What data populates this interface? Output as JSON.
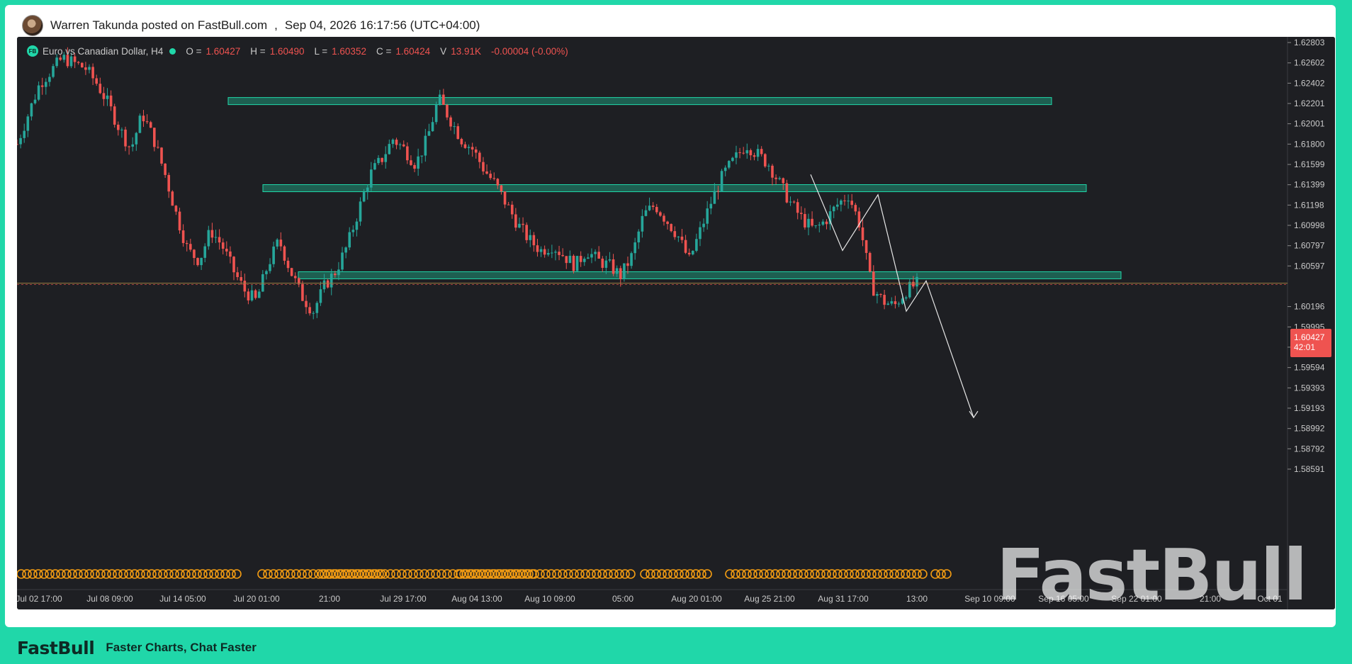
{
  "post": {
    "author_line": "Warren Takunda posted on FastBull.com",
    "separator": ",",
    "timestamp": "Sep 04, 2026 16:17:56 (UTC+04:00)"
  },
  "legend": {
    "badge": "FB",
    "symbol": "Euro vs Canadian Dollar, H4",
    "o_label": "O =",
    "o_value": "1.60427",
    "h_label": "H =",
    "h_value": "1.60490",
    "l_label": "L =",
    "l_value": "1.60352",
    "c_label": "C =",
    "c_value": "1.60424",
    "v_label": "V",
    "v_value": "13.91K",
    "change": "-0.00004 (-0.00%)"
  },
  "price_tag": {
    "price": "1.60427",
    "countdown": "42:01"
  },
  "watermark": "FastBull",
  "footer": {
    "logo": "FastBull",
    "tagline": "Faster Charts, Chat Faster"
  },
  "colors": {
    "background": "#1e1f23",
    "up": "#26a69a",
    "down": "#ef5350",
    "zone": "#20d7a9",
    "price_line": "#9e7f42",
    "event_marker": "#f39c12",
    "brand": "#20d7a9"
  },
  "chart_data": {
    "type": "candlestick",
    "title": "Euro vs Canadian Dollar, H4",
    "ylim": [
      1.5851,
      1.629
    ],
    "y_ticks": [
      "1.62803",
      "1.62602",
      "1.62402",
      "1.62201",
      "1.62001",
      "1.61800",
      "1.61599",
      "1.61399",
      "1.61198",
      "1.60998",
      "1.60797",
      "1.60597",
      "1.60196",
      "1.59995",
      "1.59795",
      "1.59594",
      "1.59393",
      "1.59193",
      "1.58992",
      "1.58792",
      "1.58591"
    ],
    "x_ticks": [
      "Jul 02 17:00",
      "Jul 08 09:00",
      "Jul 14 05:00",
      "Jul 20 01:00",
      "21:00",
      "Jul 29 17:00",
      "Aug 04 13:00",
      "Aug 10 09:00",
      "05:00",
      "Aug 20 01:00",
      "Aug 25 21:00",
      "Aug 31 17:00",
      "13:00",
      "Sep 10 09:00",
      "Sep 16 05:00",
      "Sep 22 01:00",
      "21:00",
      "Oct 01"
    ],
    "close_path": [
      [
        0,
        1.618
      ],
      [
        2,
        1.624
      ],
      [
        4,
        1.6265
      ],
      [
        6,
        1.6255
      ],
      [
        7,
        1.624
      ],
      [
        8,
        1.622
      ],
      [
        9,
        1.6195
      ],
      [
        10,
        1.6175
      ],
      [
        11,
        1.621
      ],
      [
        12,
        1.6185
      ],
      [
        13,
        1.615
      ],
      [
        14,
        1.611
      ],
      [
        15,
        1.6075
      ],
      [
        16,
        1.6065
      ],
      [
        17,
        1.6095
      ],
      [
        18,
        1.608
      ],
      [
        19,
        1.6055
      ],
      [
        20,
        1.6035
      ],
      [
        21,
        1.6025
      ],
      [
        22,
        1.606
      ],
      [
        23,
        1.6085
      ],
      [
        24,
        1.6055
      ],
      [
        25,
        1.603
      ],
      [
        26,
        1.6015
      ],
      [
        27,
        1.604
      ],
      [
        28,
        1.6055
      ],
      [
        29,
        1.608
      ],
      [
        30,
        1.6115
      ],
      [
        31,
        1.615
      ],
      [
        32,
        1.6165
      ],
      [
        33,
        1.6185
      ],
      [
        34,
        1.6175
      ],
      [
        35,
        1.616
      ],
      [
        36,
        1.6185
      ],
      [
        37,
        1.6225
      ],
      [
        38,
        1.6205
      ],
      [
        39,
        1.6185
      ],
      [
        40,
        1.6175
      ],
      [
        41,
        1.6155
      ],
      [
        42,
        1.614
      ],
      [
        43,
        1.612
      ],
      [
        44,
        1.61
      ],
      [
        45,
        1.6085
      ],
      [
        46,
        1.6075
      ],
      [
        47,
        1.608
      ],
      [
        48,
        1.607
      ],
      [
        49,
        1.606
      ],
      [
        50,
        1.6075
      ],
      [
        51,
        1.6065
      ],
      [
        52,
        1.606
      ],
      [
        53,
        1.605
      ],
      [
        54,
        1.607
      ],
      [
        55,
        1.611
      ],
      [
        56,
        1.612
      ],
      [
        57,
        1.6105
      ],
      [
        58,
        1.609
      ],
      [
        59,
        1.6065
      ],
      [
        60,
        1.6095
      ],
      [
        61,
        1.6125
      ],
      [
        62,
        1.615
      ],
      [
        63,
        1.6165
      ],
      [
        64,
        1.618
      ],
      [
        65,
        1.617
      ],
      [
        66,
        1.616
      ],
      [
        67,
        1.614
      ],
      [
        68,
        1.612
      ],
      [
        69,
        1.6105
      ],
      [
        70,
        1.6095
      ],
      [
        71,
        1.6105
      ],
      [
        72,
        1.612
      ],
      [
        73,
        1.613
      ],
      [
        74,
        1.61
      ],
      [
        75,
        1.604
      ],
      [
        76,
        1.6025
      ],
      [
        77,
        1.602
      ],
      [
        78,
        1.6035
      ],
      [
        79,
        1.6042
      ]
    ],
    "zones": [
      {
        "from": 1.6219,
        "to": 1.6226
      },
      {
        "from": 1.6133,
        "to": 1.614
      },
      {
        "from": 1.6047,
        "to": 1.6054
      }
    ],
    "current_price": 1.60427,
    "projection_path": [
      [
        1.6055
      ],
      [
        1.591
      ]
    ],
    "event_markers": true
  }
}
